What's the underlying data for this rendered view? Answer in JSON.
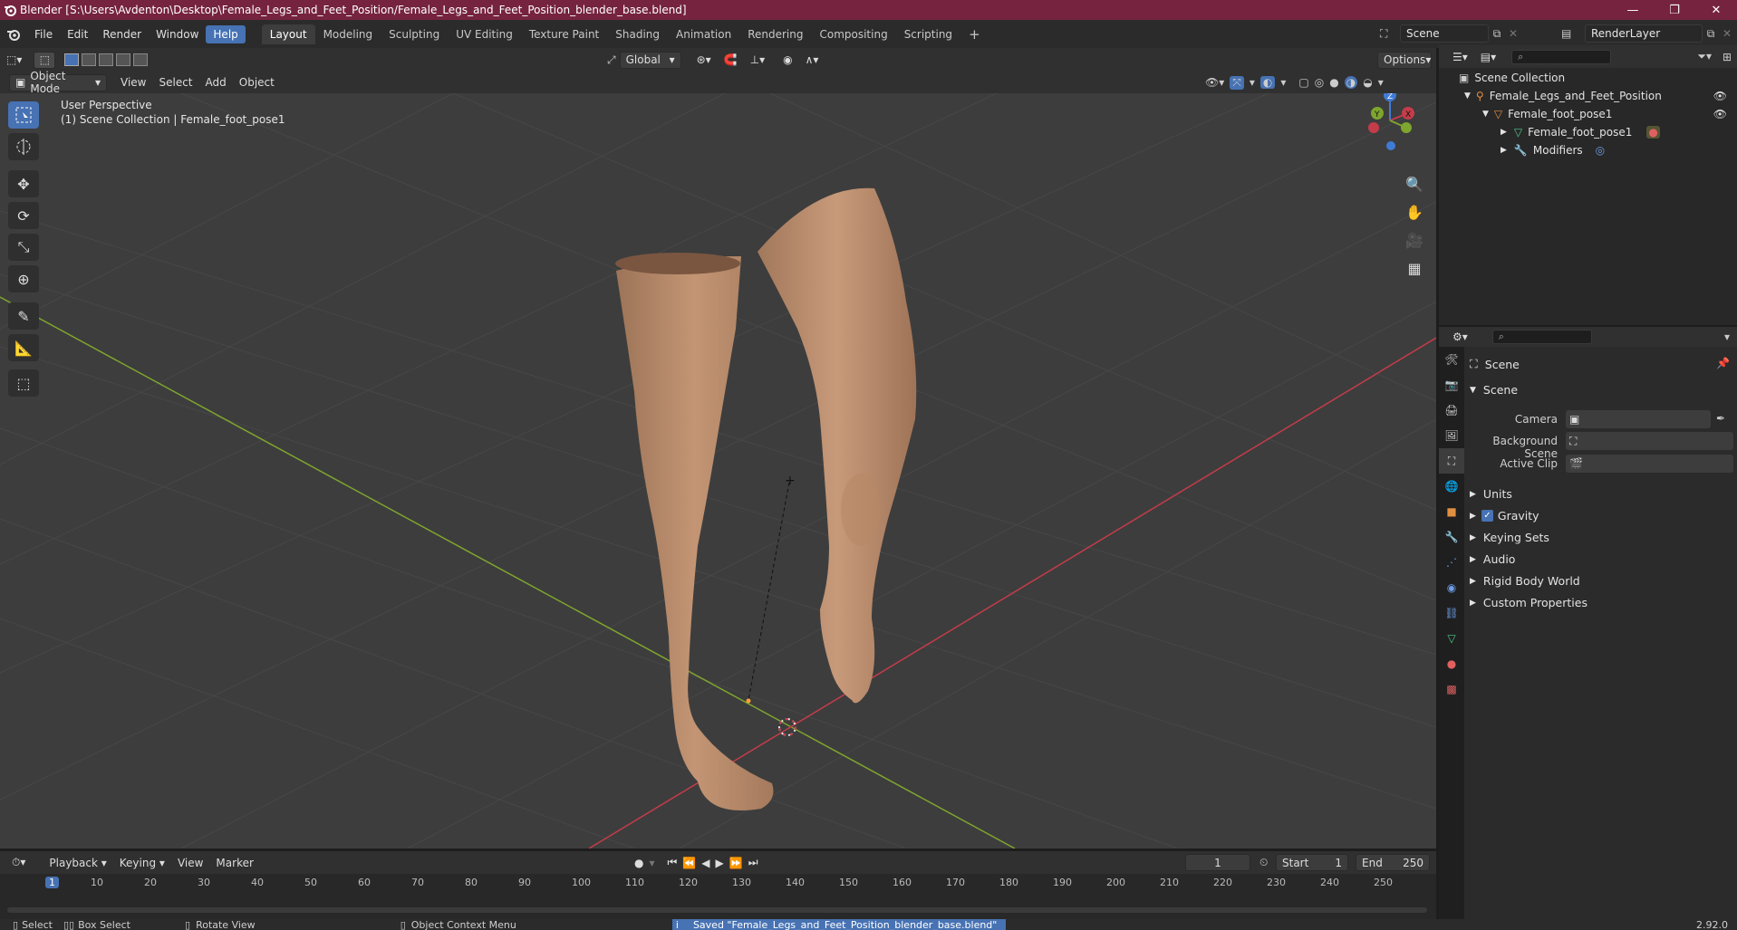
{
  "window": {
    "title": "Blender [S:\\Users\\Avdenton\\Desktop\\Female_Legs_and_Feet_Position/Female_Legs_and_Feet_Position_blender_base.blend]",
    "minimize": "—",
    "maximize": "❐",
    "close": "✕"
  },
  "menu": {
    "file": "File",
    "edit": "Edit",
    "render": "Render",
    "window": "Window",
    "help": "Help"
  },
  "workspaces": [
    "Layout",
    "Modeling",
    "Sculpting",
    "UV Editing",
    "Texture Paint",
    "Shading",
    "Animation",
    "Rendering",
    "Compositing",
    "Scripting"
  ],
  "add_workspace": "+",
  "scene_field": "Scene",
  "renderlayer_field": "RenderLayer",
  "viewport": {
    "transform_orientation": "Global",
    "options": "Options",
    "mode": "Object Mode",
    "menu_view": "View",
    "menu_select": "Select",
    "menu_add": "Add",
    "menu_object": "Object",
    "overlay_title": "User Perspective",
    "overlay_subtitle": "(1) Scene Collection | Female_foot_pose1",
    "gizmo_z": "Z",
    "gizmo_y": "Y",
    "gizmo_x": "X"
  },
  "outliner": {
    "scene_collection": "Scene Collection",
    "items": [
      {
        "label": "Female_Legs_and_Feet_Position"
      },
      {
        "label": "Female_foot_pose1"
      },
      {
        "label": "Female_foot_pose1"
      },
      {
        "label": "Modifiers"
      }
    ]
  },
  "properties": {
    "header": "Scene",
    "section_scene": "Scene",
    "camera_label": "Camera",
    "bg_scene_label": "Background Scene",
    "active_clip_label": "Active Clip",
    "sections": [
      "Units",
      "Gravity",
      "Keying Sets",
      "Audio",
      "Rigid Body World",
      "Custom Properties"
    ],
    "gravity_checked": true
  },
  "timeline": {
    "playback": "Playback",
    "keying": "Keying",
    "view": "View",
    "marker": "Marker",
    "current_frame": "1",
    "start_label": "Start",
    "start_value": "1",
    "end_label": "End",
    "end_value": "250",
    "ticks": [
      "1",
      "10",
      "20",
      "30",
      "40",
      "50",
      "60",
      "70",
      "80",
      "90",
      "100",
      "110",
      "120",
      "130",
      "140",
      "150",
      "160",
      "170",
      "180",
      "190",
      "200",
      "210",
      "220",
      "230",
      "240",
      "250"
    ]
  },
  "status": {
    "select": "Select",
    "box_select": "Box Select",
    "rotate_view": "Rotate View",
    "context_menu": "Object Context Menu",
    "message": "Saved \"Female_Legs_and_Feet_Position_blender_base.blend\"",
    "version": "2.92.0"
  },
  "colors": {
    "accent": "#4772b3",
    "titlebar": "#75233f",
    "x_axis": "#c43c4a",
    "y_axis": "#7ea52e",
    "z_axis": "#3f7bd6"
  }
}
